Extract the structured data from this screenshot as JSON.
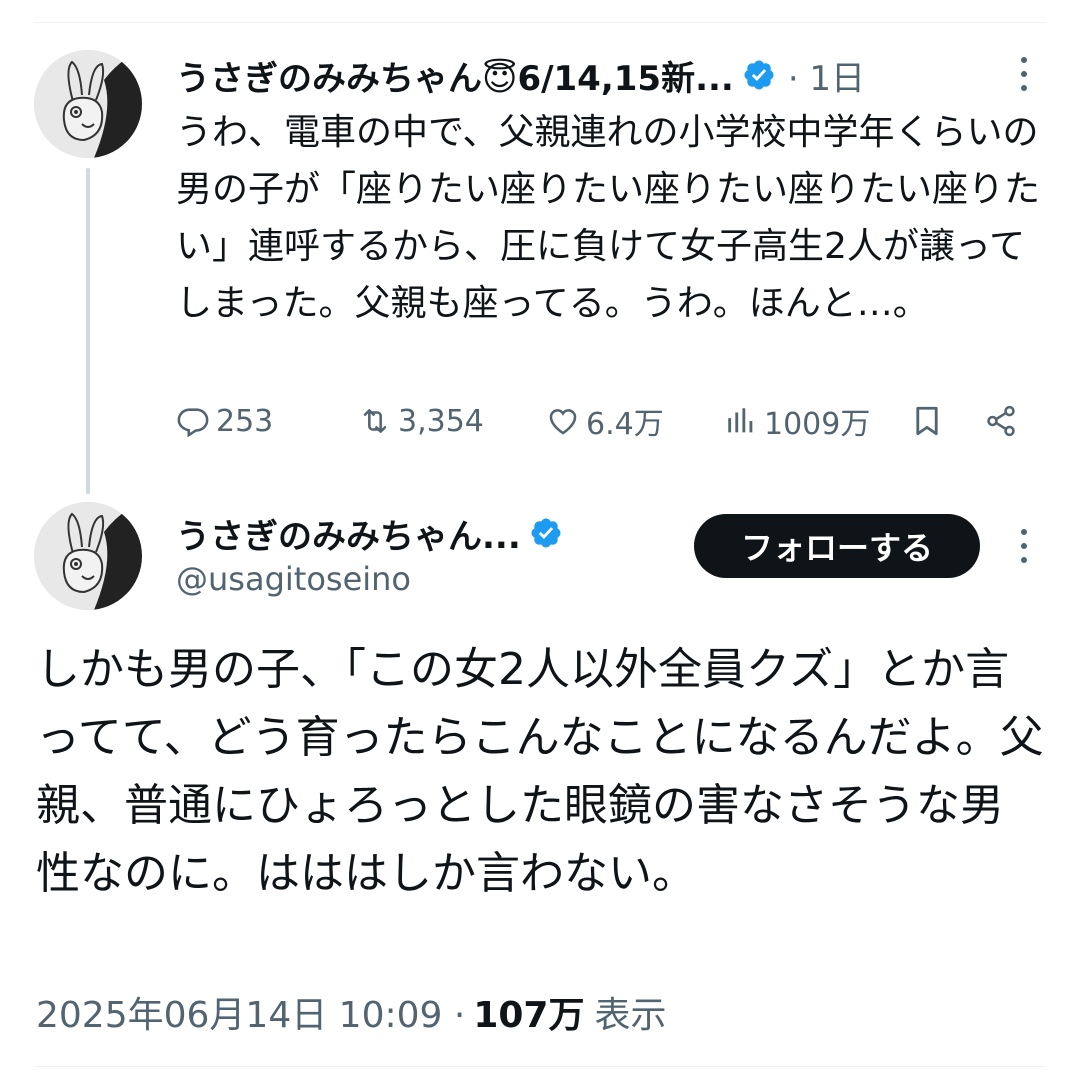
{
  "thread": {
    "parent": {
      "display_name": "うさぎのみみちゃん😇6/14,15新...",
      "timestamp": "· 1日",
      "text": "うわ、電車の中で、父親連れの小学校中学年くらいの男の子が「座りたい座りたい座りたい座りたい座りたい」連呼するから、圧に負けて女子高生2人が譲ってしまった。父親も座ってる。うわ。ほんと…。",
      "stats": {
        "replies": "253",
        "retweets": "3,354",
        "likes": "6.4万",
        "views": "1009万"
      }
    },
    "main": {
      "display_name": "うさぎのみみちゃん...",
      "handle": "@usagitoseino",
      "follow_label": "フォローする",
      "text": "しかも男の子、「この女2人以外全員クズ」とか言ってて、どう育ったらこんなことになるんだよ。父親、普通にひょろっとした眼鏡の害なさそうな男性なのに。はははしか言わない。",
      "datetime": "2025年06月14日 10:09 ·",
      "view_count": "107万",
      "view_label": "表示"
    }
  },
  "icons": {
    "verified": "verified-badge-icon",
    "more": "more-vertical-icon",
    "reply": "reply-icon",
    "retweet": "retweet-icon",
    "like": "heart-icon",
    "views": "analytics-icon",
    "bookmark": "bookmark-icon",
    "share": "share-icon"
  },
  "colors": {
    "text": "#0f1419",
    "secondary": "#536471",
    "verified": "#1d9bf0",
    "follow_bg": "#0f1419",
    "thread_line": "#cfd9de"
  }
}
